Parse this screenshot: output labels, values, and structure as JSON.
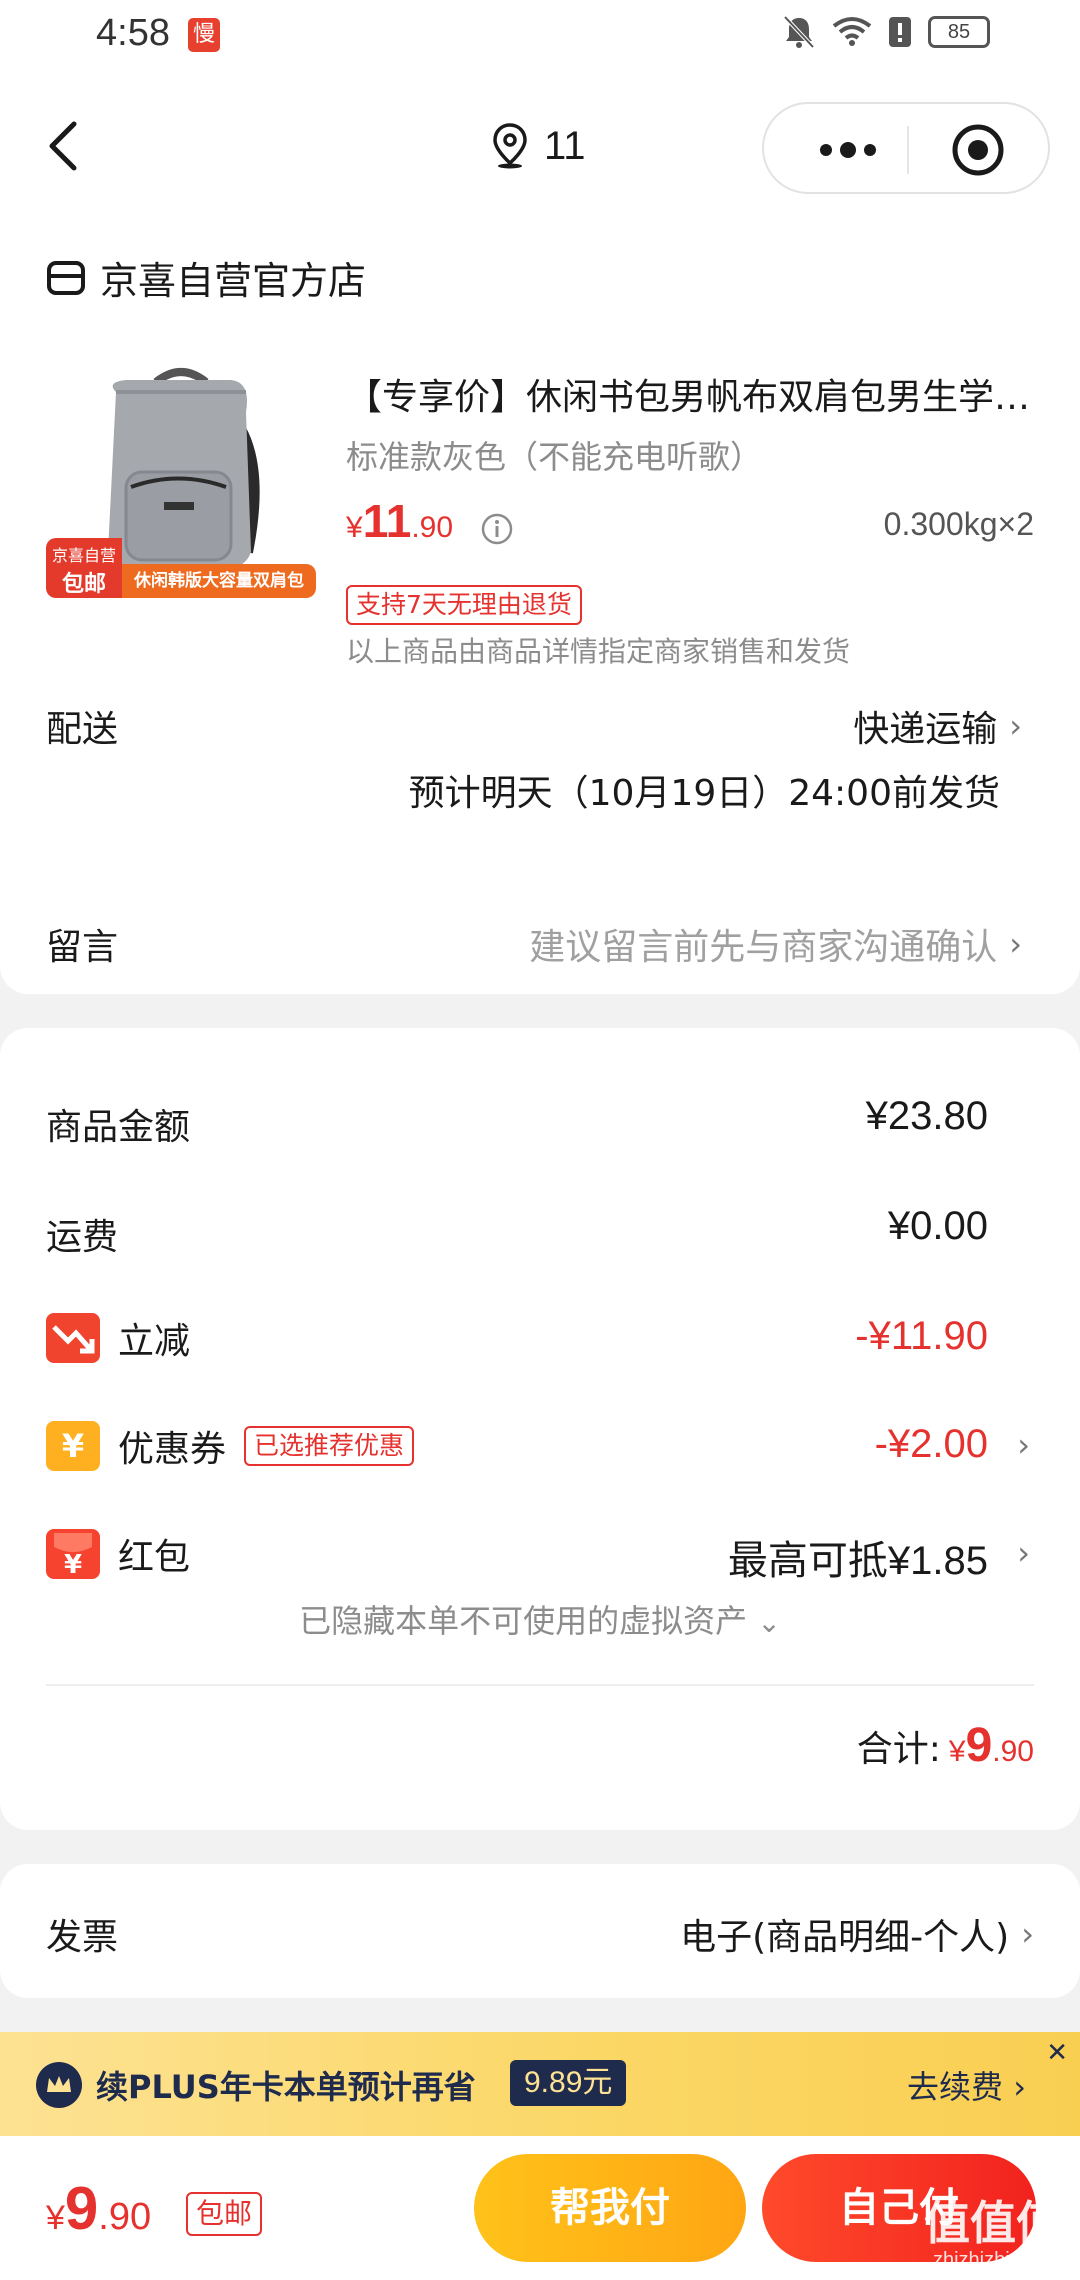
{
  "status_bar": {
    "time": "4:58",
    "app_badge": "慢",
    "battery": "85"
  },
  "nav": {
    "location_count": "11"
  },
  "store": {
    "name": "京喜自营官方店"
  },
  "product": {
    "title": "【专享价】休闲书包男帆布双肩包男生学生大容量旅行包",
    "spec": "标准款灰色（不能充电听歌）",
    "price_symbol": "¥",
    "price_int": "11",
    "price_dec": ".90",
    "qty": "0.300kg×2",
    "return_badge": "支持7天无理由退货",
    "seller_note": "以上商品由商品详情指定商家销售和发货",
    "image_tag_top": "京喜自营",
    "image_tag_free": "包邮",
    "image_tag_desc": "休闲韩版大容量双肩包"
  },
  "delivery": {
    "label": "配送",
    "method": "快递运输",
    "date": "预计明天（10月19日）24:00前发货"
  },
  "message": {
    "label": "留言",
    "hint": "建议留言前先与商家沟通确认"
  },
  "summary": {
    "goods_label": "商品金额",
    "goods_value": "¥23.80",
    "shipping_label": "运费",
    "shipping_value": "¥0.00",
    "discount_label": "立减",
    "discount_value": "-¥11.90",
    "coupon_label": "优惠券",
    "coupon_tag": "已选推荐优惠",
    "coupon_value": "-¥2.00",
    "redpacket_label": "红包",
    "redpacket_value": "最高可抵¥1.85",
    "hidden_assets": "已隐藏本单不可使用的虚拟资产",
    "total_label": "合计:",
    "total_symbol": "¥",
    "total_int": "9",
    "total_dec": ".90"
  },
  "invoice": {
    "label": "发票",
    "value": "电子(商品明细-个人)"
  },
  "plus_banner": {
    "text": "续PLUS年卡本单预计再省",
    "save": "9.89元",
    "renew": "去续费"
  },
  "bottom": {
    "price_symbol": "¥",
    "price_int": "9",
    "price_dec": ".90",
    "free_ship": "包邮",
    "help_pay": "帮我付",
    "self_pay": "自己付",
    "watermark_big": "值值值",
    "watermark_url": "zhizhizhi.com"
  },
  "colors": {
    "accent_red": "#e6322e",
    "plus_navy": "#1f2b4d",
    "plus_gold": "#fde293"
  }
}
